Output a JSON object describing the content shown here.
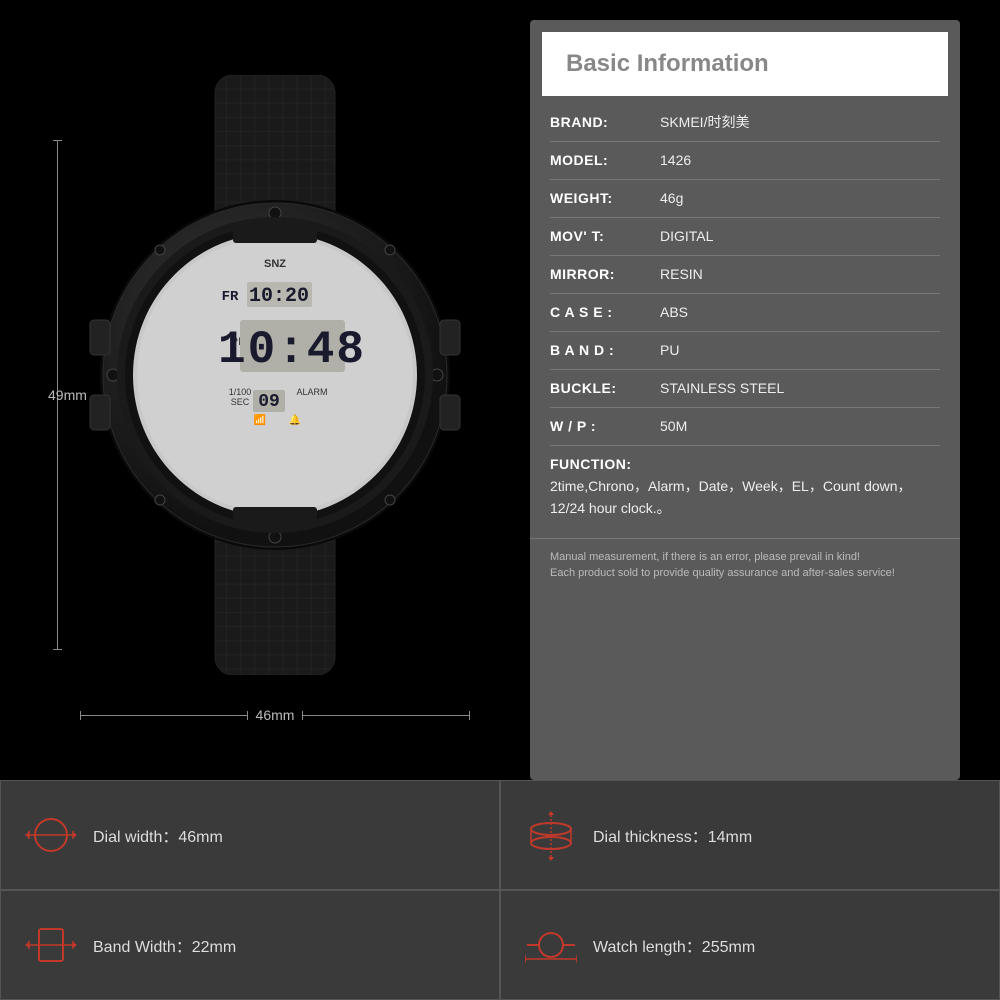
{
  "info": {
    "title": "Basic Information",
    "rows": [
      {
        "key": "BRAND:",
        "value": "SKMEI/时刻美"
      },
      {
        "key": "MODEL:",
        "value": "1426"
      },
      {
        "key": "WEIGHT:",
        "value": "46g"
      },
      {
        "key": "MOV' T:",
        "value": "DIGITAL"
      },
      {
        "key": "MIRROR:",
        "value": "RESIN"
      },
      {
        "key": "C A S E :",
        "value": "ABS"
      },
      {
        "key": "B A N D :",
        "value": "PU"
      },
      {
        "key": "BUCKLE:",
        "value": "STAINLESS STEEL"
      },
      {
        "key": "W / P :",
        "value": "50M"
      },
      {
        "key": "FUNCTION:",
        "value": "2time,Chrono，Alarm，Date，Week，EL，Count down，12/24 hour clock.。"
      }
    ],
    "note1": "Manual measurement, if there is an error, please prevail in kind!",
    "note2": "Each product sold to provide quality assurance and after-sales service!"
  },
  "dims": {
    "height": "49mm",
    "width": "46mm"
  },
  "specs": [
    {
      "icon": "dial-width-icon",
      "label": "Dial width：",
      "value": "46mm"
    },
    {
      "icon": "dial-thickness-icon",
      "label": "Dial thickness：",
      "value": "14mm"
    },
    {
      "icon": "band-width-icon",
      "label": "Band Width：",
      "value": "22mm"
    },
    {
      "icon": "watch-length-icon",
      "label": "Watch length：",
      "value": "255mm"
    }
  ]
}
